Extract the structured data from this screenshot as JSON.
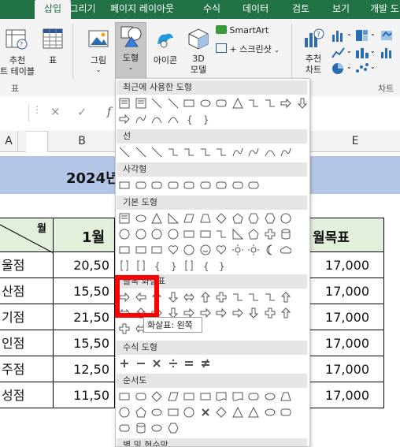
{
  "tabs": [
    "삽입",
    "그리기",
    "페이지 레이아웃",
    "수식",
    "데이터",
    "검토",
    "보기",
    "개발 도"
  ],
  "active_tab_index": 0,
  "ribbon": {
    "pivot_label_line1": "추천",
    "pivot_label_line2": "트 테이블",
    "table_label": "표",
    "pictures_label": "그림",
    "shapes_label": "도형",
    "icons_label": "아이콘",
    "model3d_line1": "3D",
    "model3d_line2": "모델",
    "smartart_label": "SmartArt",
    "screenshot_label": "스크린샷",
    "rec_charts_line1": "추천",
    "rec_charts_line2": "차트",
    "group_table_label": "표",
    "group_chart_label": "차트"
  },
  "column_headers": [
    "A",
    "B",
    "E"
  ],
  "sheet": {
    "title_partial": "2024년",
    "header_month": "월",
    "header_jan": "1월",
    "header_target": "월목표",
    "rows": [
      {
        "store": "울점",
        "jan": "20,50",
        "target": "17,000"
      },
      {
        "store": "산점",
        "jan": "15,50",
        "target": "17,000"
      },
      {
        "store": "기점",
        "jan": "21,50",
        "target": "17,000"
      },
      {
        "store": "인점",
        "jan": "15,50",
        "target": "17,000"
      },
      {
        "store": "주점",
        "jan": "12,50",
        "target": "17,000"
      },
      {
        "store": "성점",
        "jan": "11,50",
        "target": "17,000"
      }
    ]
  },
  "gallery": {
    "sections": [
      {
        "label": "최근에 사용한 도형"
      },
      {
        "label": "선"
      },
      {
        "label": "사각형"
      },
      {
        "label": "기본 도형"
      },
      {
        "label": "블록 화살표"
      },
      {
        "label": "수식 도형"
      },
      {
        "label": "순서도"
      },
      {
        "label": "별 및 현수막"
      }
    ],
    "tooltip": "화살표: 왼쪽"
  },
  "colors": {
    "excel_green": "#217346",
    "title_fill": "#b4c6e7",
    "header_fill": "#e2efda",
    "highlight": "#ff0000"
  }
}
